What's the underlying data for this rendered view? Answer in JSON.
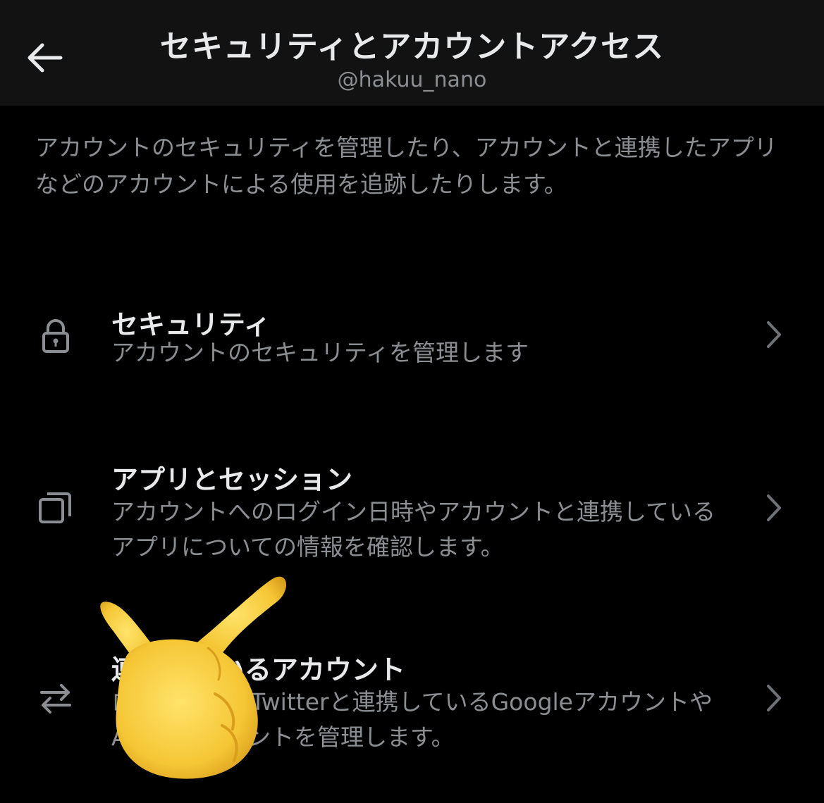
{
  "header": {
    "title": "セキュリティとアカウントアクセス",
    "subtitle": "@hakuu_nano",
    "back_icon": "arrow-left-icon"
  },
  "description": "アカウントのセキュリティを管理したり、アカウントと連携したアプリなどのアカウントによる使用を追跡したりします。",
  "menu": [
    {
      "icon": "lock-icon",
      "title": "セキュリティ",
      "description": "アカウントのセキュリティを管理します"
    },
    {
      "icon": "copy-icon",
      "title": "アプリとセッション",
      "description": "アカウントへのログイン日時やアカウントと連携しているアプリについての情報を確認します。"
    },
    {
      "icon": "swap-arrows-icon",
      "title": "連携しているアカウント",
      "description": "ログインなどTwitterと連携しているGoogleアカウントやAppleアカウントを管理します。"
    }
  ],
  "overlay": {
    "sticker": "pointing-hand-icon"
  },
  "colors": {
    "background": "#000000",
    "header_bg": "#121212",
    "primary_text": "#e7e9ea",
    "secondary_text": "#8b8f93",
    "sticker": "#f5c635"
  }
}
